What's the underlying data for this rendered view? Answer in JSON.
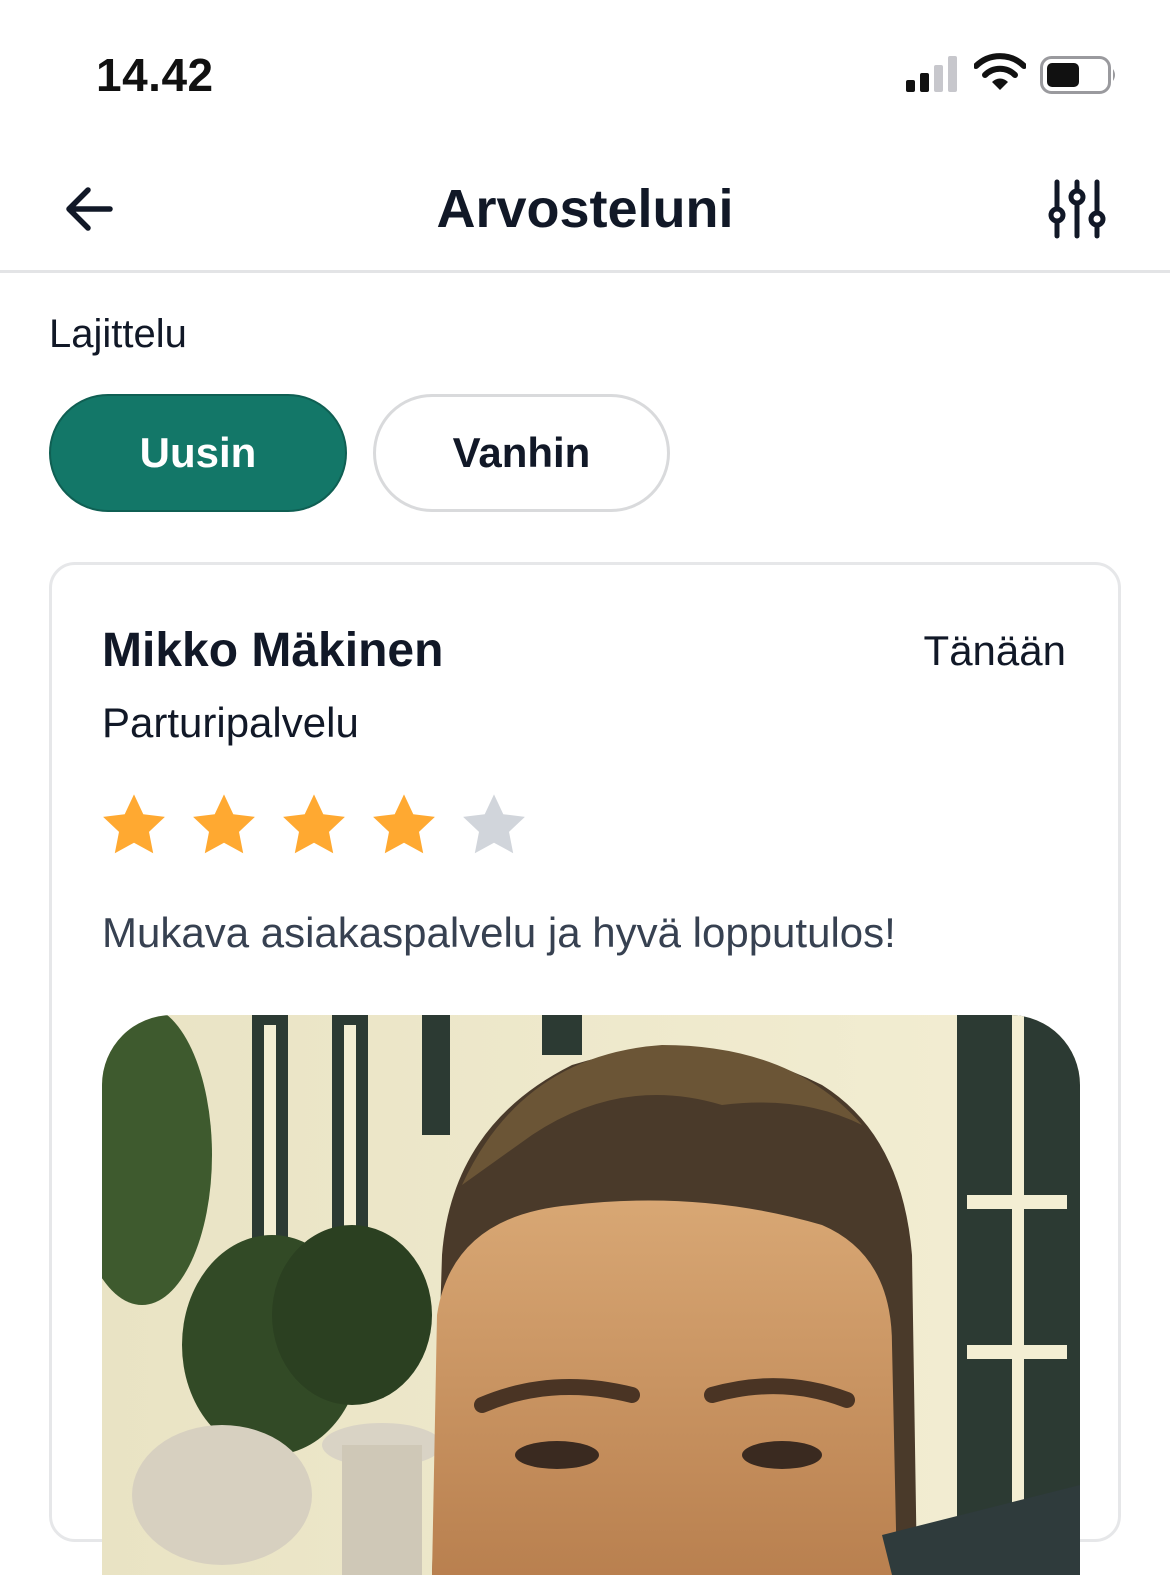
{
  "status_bar": {
    "time": "14.42",
    "signal_icon": "cellular-signal-icon",
    "wifi_icon": "wifi-icon",
    "battery_icon": "battery-icon"
  },
  "nav": {
    "title": "Arvosteluni",
    "back_icon": "arrow-left-icon",
    "filter_icon": "sliders-icon"
  },
  "sort": {
    "label": "Lajittelu",
    "options": [
      {
        "label": "Uusin",
        "selected": true
      },
      {
        "label": "Vanhin",
        "selected": false
      }
    ]
  },
  "review": {
    "reviewer": "Mikko Mäkinen",
    "date": "Tänään",
    "service": "Parturipalvelu",
    "rating": 4,
    "max_rating": 5,
    "comment": "Mukava asiakaspalvelu ja hyvä lopputulos!",
    "photo_icon": "review-photo"
  },
  "colors": {
    "accent": "#137768",
    "star_filled": "#FFA931",
    "star_empty": "#D1D5DB",
    "text": "#111827",
    "muted_text": "#374151"
  }
}
